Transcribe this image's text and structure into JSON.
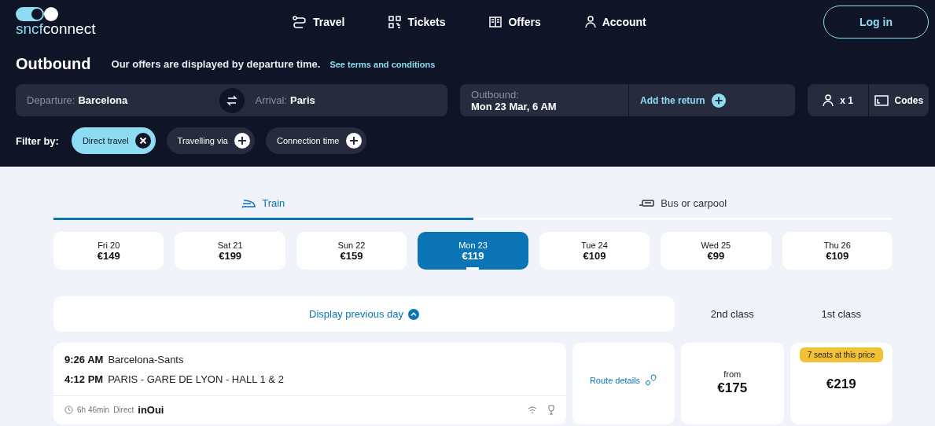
{
  "logo": {
    "brand": "sncf",
    "product": "connect"
  },
  "nav": [
    {
      "label": "Travel",
      "kind": "route"
    },
    {
      "label": "Tickets",
      "kind": "qr"
    },
    {
      "label": "Offers",
      "kind": "book"
    },
    {
      "label": "Account",
      "kind": "user"
    }
  ],
  "login_button": "Log in",
  "heading": {
    "title": "Outbound",
    "note": "Our offers are displayed by departure time.",
    "link": "See terms and conditions"
  },
  "search": {
    "departure": {
      "label": "Departure:",
      "value": "Barcelona"
    },
    "arrival": {
      "label": "Arrival:",
      "value": "Paris"
    },
    "outbound": {
      "label": "Outbound:",
      "value": "Mon 23 Mar, 6 AM"
    },
    "add_return": "Add the return",
    "passengers": "x 1",
    "codes": "Codes"
  },
  "filters": {
    "label": "Filter by:",
    "items": [
      {
        "label": "Direct travel",
        "selected": true
      },
      {
        "label": "Travelling via",
        "selected": false
      },
      {
        "label": "Connection time",
        "selected": false
      }
    ]
  },
  "tabs": [
    {
      "label": "Train",
      "kind": "train",
      "selected": true
    },
    {
      "label": "Bus or carpool",
      "kind": "bus",
      "selected": false
    }
  ],
  "dates": [
    {
      "day": "Fri 20",
      "price": "€149",
      "selected": false
    },
    {
      "day": "Sat 21",
      "price": "€199",
      "selected": false
    },
    {
      "day": "Sun 22",
      "price": "€159",
      "selected": false
    },
    {
      "day": "Mon 23",
      "price": "€119",
      "selected": true
    },
    {
      "day": "Tue 24",
      "price": "€109",
      "selected": false
    },
    {
      "day": "Wed 25",
      "price": "€99",
      "selected": false
    },
    {
      "day": "Thu 26",
      "price": "€109",
      "selected": false
    }
  ],
  "results_header": {
    "previous_day": "Display previous day",
    "columns": [
      "2nd class",
      "1st class"
    ]
  },
  "journeys": [
    {
      "departure_time": "9:26 AM",
      "departure_station": "Barcelona-Sants",
      "arrival_time": "4:12 PM",
      "arrival_station": "PARIS - GARE DE LYON - HALL 1 & 2",
      "duration": "6h 46min",
      "type": "Direct",
      "operator": "inOui",
      "route_details": "Route details",
      "second_class": {
        "prefix": "from",
        "price": "€175"
      },
      "first_class": {
        "badge": "7 seats at this price",
        "price": "€219"
      }
    }
  ]
}
